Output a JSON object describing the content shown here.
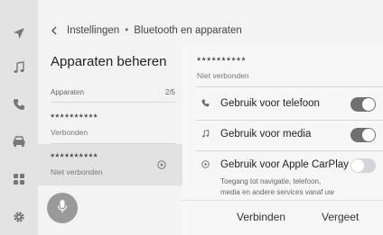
{
  "breadcrumb": {
    "back_icon": "chevron-left-icon",
    "part1": "Instellingen",
    "separator": "•",
    "part2": "Bluetooth en apparaten"
  },
  "rail": {
    "icons": [
      "navigation-arrow-icon",
      "music-note-icon",
      "phone-icon",
      "car-icon",
      "apps-grid-icon",
      "settings-gear-icon"
    ]
  },
  "left": {
    "title": "Apparaten beheren",
    "section_label": "Apparaten",
    "section_count": "2/5",
    "devices": [
      {
        "name": "**********",
        "status": "Verbonden"
      },
      {
        "name": "**********",
        "status": "Niet verbonden",
        "icon": "carplay-icon"
      }
    ],
    "mic_icon": "microphone-icon"
  },
  "right": {
    "device_name": "**********",
    "device_status": "Niet verbonden",
    "options": [
      {
        "label": "Gebruik voor telefoon",
        "icon": "phone-icon",
        "state": "on"
      },
      {
        "label": "Gebruik voor media",
        "icon": "music-note-icon",
        "state": "on"
      },
      {
        "label": "Gebruik voor Apple CarPlay",
        "icon": "carplay-icon",
        "state": "off",
        "description": "Toegang tot navigatie, telefoon, media en andere services vanaf uw apparaat"
      }
    ],
    "connect_label": "Verbinden",
    "forget_label": "Vergeet"
  },
  "colors": {
    "toggle_on": "#707070",
    "toggle_off": "#d4d4dc",
    "mic_button": "#9a9a9a"
  }
}
